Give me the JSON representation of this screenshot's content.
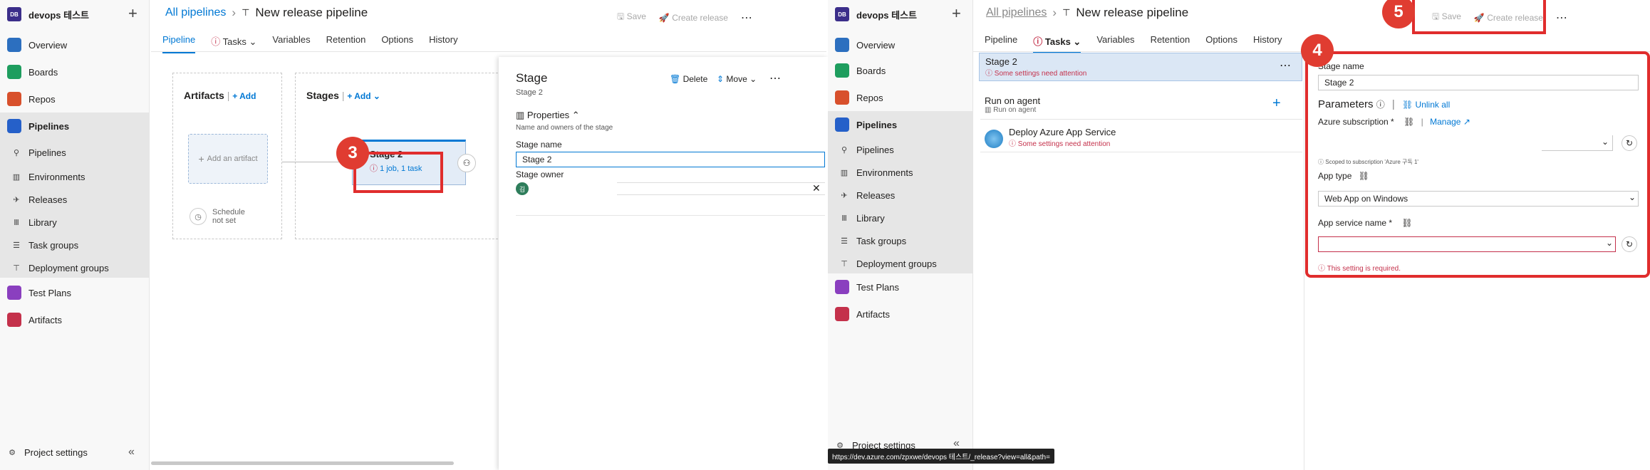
{
  "left": {
    "org": {
      "logo": "DB",
      "name": "devops 테스트"
    },
    "nav": {
      "overview": "Overview",
      "boards": "Boards",
      "repos": "Repos",
      "pipelines": "Pipelines",
      "sub": [
        "Pipelines",
        "Environments",
        "Releases",
        "Library",
        "Task groups",
        "Deployment groups"
      ],
      "test_plans": "Test Plans",
      "artifacts": "Artifacts",
      "project_settings": "Project settings"
    },
    "breadcrumb": "All pipelines",
    "title": "New release pipeline",
    "toolbar": {
      "save": "Save",
      "create_release": "Create release"
    },
    "tabs": [
      "Pipeline",
      "Tasks",
      "Variables",
      "Retention",
      "Options",
      "History"
    ],
    "artifacts": {
      "header": "Artifacts",
      "add": "Add",
      "add_artifact": "Add an artifact",
      "schedule": "Schedule not set"
    },
    "stages": {
      "header": "Stages",
      "add": "Add",
      "card_title": "Stage 2",
      "card_sub": "1 job, 1 task"
    },
    "panel": {
      "title": "Stage",
      "subtitle": "Stage 2",
      "delete": "Delete",
      "move": "Move",
      "properties": "Properties",
      "properties_desc": "Name and owners of the stage",
      "stage_name_label": "Stage name",
      "stage_name_value": "Stage 2",
      "stage_owner_label": "Stage owner",
      "owner_initial": "김"
    },
    "badge": "3"
  },
  "right": {
    "org": {
      "logo": "DB",
      "name": "devops 테스트"
    },
    "breadcrumb": "All pipelines",
    "title": "New release pipeline",
    "toolbar": {
      "save": "Save",
      "create_release": "Create release"
    },
    "tabs": [
      "Pipeline",
      "Tasks",
      "Variables",
      "Retention",
      "Options",
      "History"
    ],
    "stage_item": {
      "title": "Stage 2",
      "warning": "Some settings need attention"
    },
    "agent": {
      "title": "Run on agent",
      "sub": "Run on agent"
    },
    "task": {
      "title": "Deploy Azure App Service",
      "warning": "Some settings need attention"
    },
    "form": {
      "stage_name_label": "Stage name",
      "stage_name_value": "Stage 2",
      "parameters": "Parameters",
      "unlink_all": "Unlink all",
      "azure_sub_label": "Azure subscription *",
      "manage": "Manage",
      "scoped": "Scoped to subscription 'Azure 구독 1'",
      "app_type_label": "App type",
      "app_type_value": "Web App on Windows",
      "app_service_label": "App service name *",
      "required_msg": "This setting is required."
    },
    "status_url": "https://dev.azure.com/zpxwe/devops 테스트/_release?view=all&path=",
    "badge4": "4",
    "badge5": "5"
  },
  "colors": {
    "accent": "#0078d4",
    "error": "#c4314b",
    "annotation": "#e02d2d"
  }
}
